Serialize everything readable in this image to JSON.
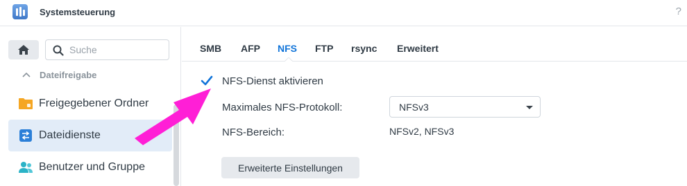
{
  "window": {
    "title": "Systemsteuerung",
    "help_label": "?"
  },
  "sidebar": {
    "search": {
      "placeholder": "Suche",
      "value": ""
    },
    "group": {
      "label": "Dateifreigabe"
    },
    "items": [
      {
        "label": "Freigegebener Ordner",
        "icon": "folder-icon"
      },
      {
        "label": "Dateidienste",
        "icon": "file-services-icon",
        "active": true
      },
      {
        "label": "Benutzer und Gruppe",
        "icon": "users-icon"
      }
    ]
  },
  "tabs": [
    {
      "label": "SMB"
    },
    {
      "label": "AFP"
    },
    {
      "label": "NFS",
      "active": true
    },
    {
      "label": "FTP"
    },
    {
      "label": "rsync"
    },
    {
      "label": "Erweitert"
    }
  ],
  "nfs": {
    "enable_label": "NFS-Dienst aktivieren",
    "enable_checked": true,
    "max_protocol_label": "Maximales NFS-Protokoll:",
    "max_protocol_value": "NFSv3",
    "range_label": "NFS-Bereich:",
    "range_value": "NFSv2, NFSv3",
    "advanced_button": "Erweiterte Einstellungen"
  },
  "colors": {
    "accent": "#0f73d9",
    "annotation_arrow": "#ff1fd6"
  }
}
